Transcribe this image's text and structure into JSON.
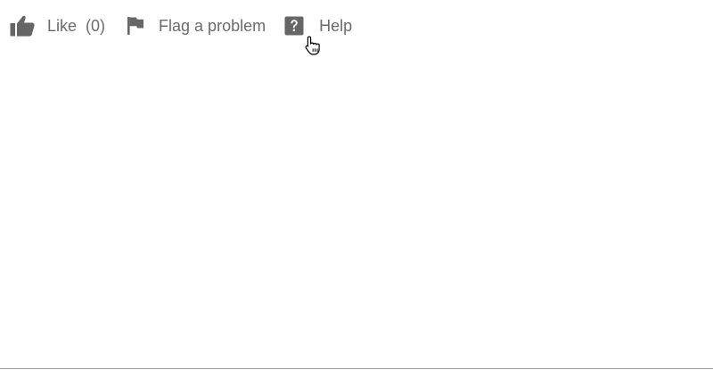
{
  "toolbar": {
    "like": {
      "label": "Like",
      "count": "(0)",
      "icon": "thumbs-up-icon"
    },
    "flag": {
      "label": "Flag a problem",
      "icon": "flag-icon"
    },
    "help": {
      "label": "Help",
      "icon": "question-mark-icon"
    }
  },
  "colors": {
    "icon": "#666666",
    "text": "#6b6b6b",
    "rule": "#9a9a9a"
  }
}
